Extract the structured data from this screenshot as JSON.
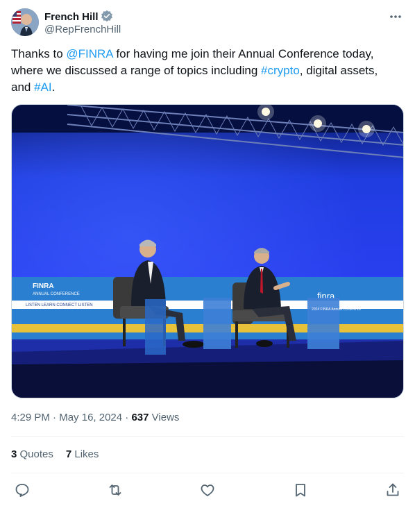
{
  "author": {
    "name": "French Hill",
    "handle": "@RepFrenchHill",
    "verified_icon": "verified-badge-icon"
  },
  "tweet": {
    "text_1": "Thanks to ",
    "mention": "@FINRA",
    "text_2": " for having me join their Annual Conference today, where we discussed a range of topics including ",
    "hashtag_1": "#crypto",
    "text_3": ", digital assets, and ",
    "hashtag_2": "#AI",
    "text_4": "."
  },
  "media": {
    "stage_banner_1": "FINRA",
    "stage_banner_sub": "ANNUAL CONFERENCE",
    "stage_tagline": "LISTEN    LEARN    CONNECT    LISTEN",
    "podium_text": "2024 FINRA Annual Conference",
    "banner_right": "finra"
  },
  "meta": {
    "time": "4:29 PM",
    "sep1": " · ",
    "date": "May 16, 2024",
    "sep2": " · ",
    "views_count": "637",
    "views_label": " Views"
  },
  "stats": {
    "quotes_count": "3",
    "quotes_label": " Quotes",
    "likes_count": "7",
    "likes_label": " Likes"
  },
  "actions": [
    "reply-icon",
    "retweet-icon",
    "like-icon",
    "bookmark-icon",
    "share-icon"
  ],
  "colors": {
    "link": "#1d9bf0",
    "secondary": "#536471",
    "primary": "#0f1419"
  }
}
